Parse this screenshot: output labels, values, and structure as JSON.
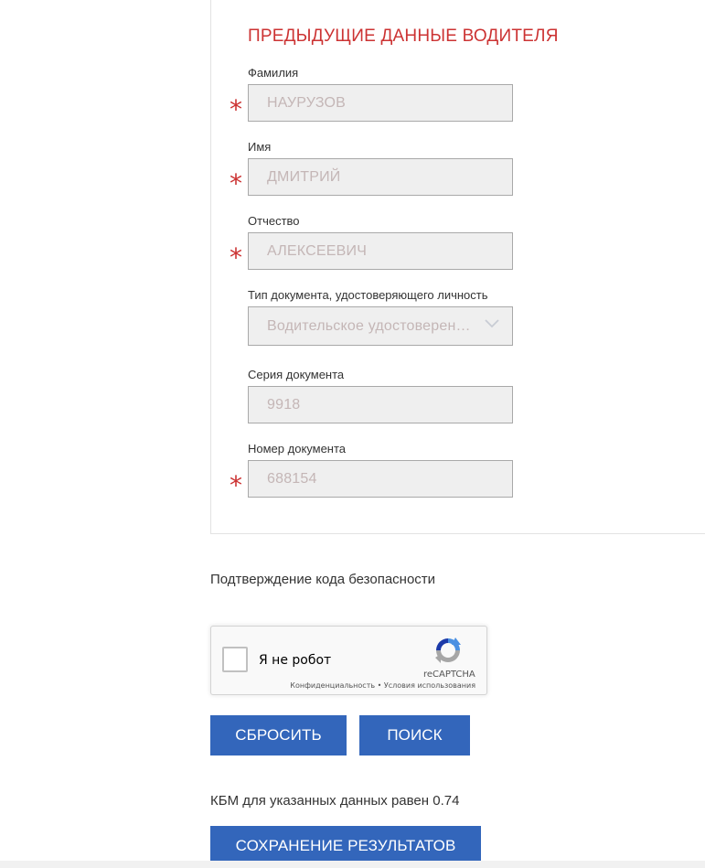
{
  "section": {
    "title": "ПРЕДЫДУЩИЕ ДАННЫЕ ВОДИТЕЛЯ"
  },
  "fields": {
    "last_name": {
      "label": "Фамилия",
      "value": "НАУРУЗОВ"
    },
    "first_name": {
      "label": "Имя",
      "value": "ДМИТРИЙ"
    },
    "patronymic": {
      "label": "Отчество",
      "value": "АЛЕКСЕЕВИЧ"
    },
    "doc_type": {
      "label": "Тип документа, удостоверяющего личность",
      "value": "Водительское удостоверение"
    },
    "doc_series": {
      "label": "Серия документа",
      "value": "9918"
    },
    "doc_number": {
      "label": "Номер документа",
      "value": "688154"
    }
  },
  "required_mark": "*",
  "captcha": {
    "title": "Подтверждение кода безопасности",
    "checkbox_label": "Я не робот",
    "brand": "reCAPTCHA",
    "privacy_link": "Конфиденциальность",
    "separator": "•",
    "terms_link": "Условия использования"
  },
  "buttons": {
    "reset": "СБРОСИТЬ",
    "search": "ПОИСК",
    "save_results": "СОХРАНЕНИЕ РЕЗУЛЬТАТОВ"
  },
  "result": {
    "text": "КБМ для указанных данных равен 0.74"
  },
  "colors": {
    "accent_red": "#cc3333",
    "button_blue": "#3366bb",
    "field_bg": "#efefef",
    "field_text": "#c4b6b6"
  }
}
